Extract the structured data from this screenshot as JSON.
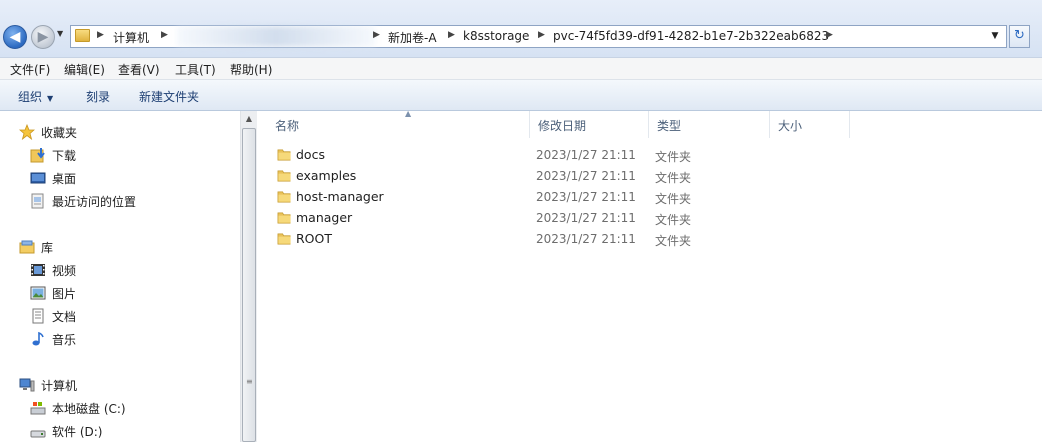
{
  "address": {
    "crumbs": [
      "计算机",
      "新加卷-A",
      "k8sstorage",
      "pvc-74f5fd39-df91-4282-b1e7-2b322eab6823"
    ]
  },
  "menu": [
    "文件(F)",
    "编辑(E)",
    "查看(V)",
    "工具(T)",
    "帮助(H)"
  ],
  "commands": {
    "organize": "组织",
    "burn": "刻录",
    "new_folder": "新建文件夹"
  },
  "nav": {
    "favorites": {
      "label": "收藏夹",
      "items": [
        "下载",
        "桌面",
        "最近访问的位置"
      ]
    },
    "libraries": {
      "label": "库",
      "items": [
        "视频",
        "图片",
        "文档",
        "音乐"
      ]
    },
    "computer": {
      "label": "计算机",
      "items": [
        "本地磁盘 (C:)",
        "软件 (D:)"
      ]
    }
  },
  "columns": {
    "name": "名称",
    "modified": "修改日期",
    "type": "类型",
    "size": "大小"
  },
  "files": [
    {
      "name": "docs",
      "modified": "2023/1/27 21:11",
      "type": "文件夹",
      "size": ""
    },
    {
      "name": "examples",
      "modified": "2023/1/27 21:11",
      "type": "文件夹",
      "size": ""
    },
    {
      "name": "host-manager",
      "modified": "2023/1/27 21:11",
      "type": "文件夹",
      "size": ""
    },
    {
      "name": "manager",
      "modified": "2023/1/27 21:11",
      "type": "文件夹",
      "size": ""
    },
    {
      "name": "ROOT",
      "modified": "2023/1/27 21:11",
      "type": "文件夹",
      "size": ""
    }
  ],
  "icons": {
    "back": "back-arrow-icon",
    "forward": "forward-arrow-icon",
    "folder": "folder-icon",
    "refresh": "refresh-icon"
  }
}
